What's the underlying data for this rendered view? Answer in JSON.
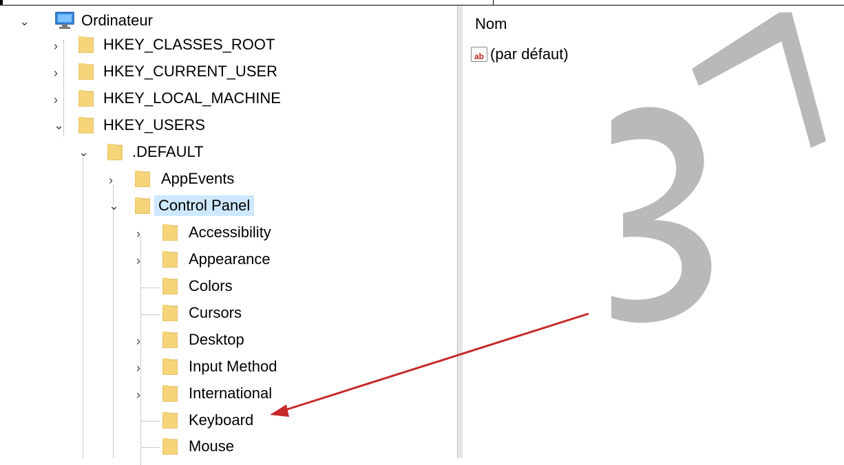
{
  "tree": {
    "root": {
      "label": "Ordinateur",
      "icon": "computer-icon",
      "expanded": true
    },
    "hives": [
      {
        "label": "HKEY_CLASSES_ROOT",
        "expanded": false
      },
      {
        "label": "HKEY_CURRENT_USER",
        "expanded": false
      },
      {
        "label": "HKEY_LOCAL_MACHINE",
        "expanded": false
      },
      {
        "label": "HKEY_USERS",
        "expanded": true
      }
    ],
    "default_key": {
      "label": ".DEFAULT",
      "expanded": true
    },
    "default_children": [
      {
        "label": "AppEvents",
        "expanded": false
      },
      {
        "label": "Control Panel",
        "expanded": true,
        "selected": true
      }
    ],
    "control_panel_children": [
      {
        "label": "Accessibility",
        "has_children": true
      },
      {
        "label": "Appearance",
        "has_children": true
      },
      {
        "label": "Colors",
        "has_children": false
      },
      {
        "label": "Cursors",
        "has_children": false
      },
      {
        "label": "Desktop",
        "has_children": true
      },
      {
        "label": "Input Method",
        "has_children": true
      },
      {
        "label": "International",
        "has_children": true
      },
      {
        "label": "Keyboard",
        "has_children": false
      },
      {
        "label": "Mouse",
        "has_children": false
      }
    ]
  },
  "values_pane": {
    "column_header": "Nom",
    "rows": [
      {
        "icon": "string-value-icon",
        "icon_text": "ab",
        "name": "(par défaut)"
      }
    ]
  },
  "annotations": {
    "watermark": "37",
    "arrow_color": "#c62828",
    "arrow_target": "Keyboard"
  },
  "colors": {
    "selection": "#cde8ff",
    "folder": "#f6d47a"
  }
}
